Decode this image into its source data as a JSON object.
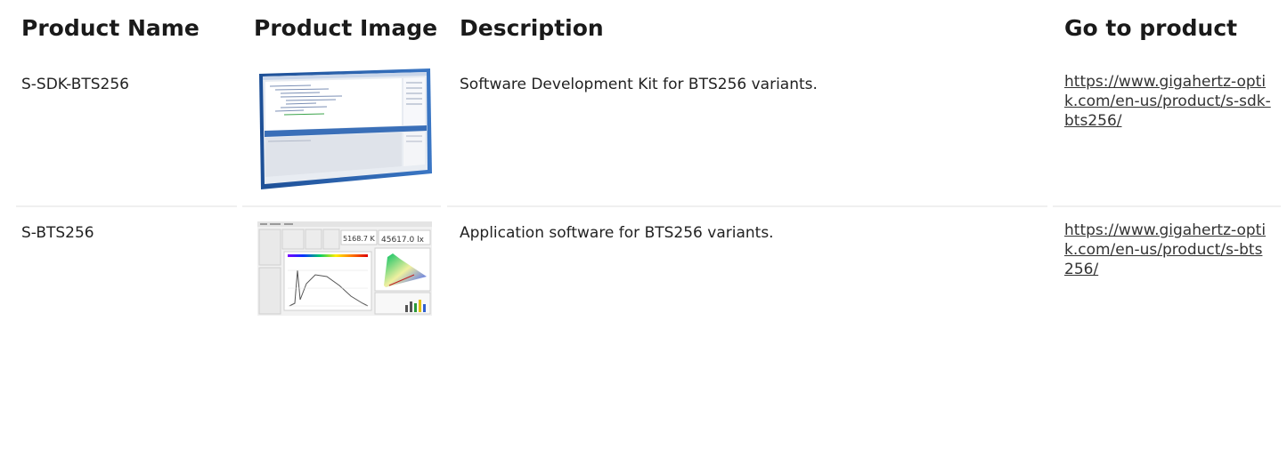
{
  "headers": {
    "name": "Product Name",
    "image": "Product Image",
    "description": "Description",
    "link": "Go to product"
  },
  "rows": [
    {
      "name": "S-SDK-BTS256",
      "description": "Software Development Kit for BTS256 variants.",
      "link": "https://www.gigahertz-optik.com/en-us/product/s-sdk-bts256/",
      "image_label": "sdk-screenshot-thumbnail"
    },
    {
      "name": "S-BTS256",
      "description": "Application software for BTS256 variants.",
      "link": "https://www.gigahertz-optik.com/en-us/product/s-bts256/",
      "image_label": "application-screenshot-thumbnail",
      "image_readouts": [
        "5168.7 K",
        "45617.0 lx"
      ]
    }
  ],
  "colors": {
    "separator": "#f0f0f0",
    "window_blue": "#2a5fa8",
    "text": "#222222"
  }
}
